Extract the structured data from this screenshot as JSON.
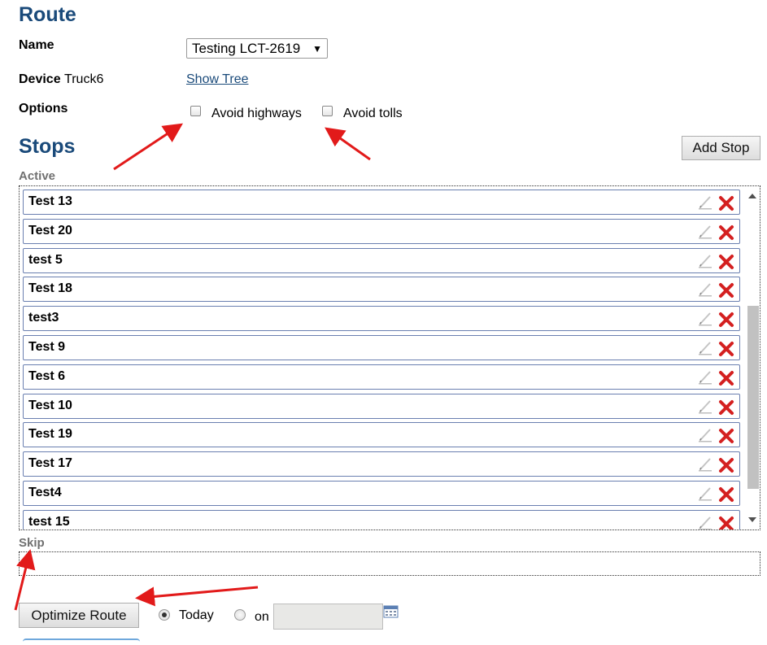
{
  "route": {
    "title": "Route",
    "name_label": "Name",
    "name_value": "Testing LCT-2619",
    "device_label": "Device",
    "device_value": "Truck6",
    "show_tree_label": "Show Tree",
    "options_label": "Options",
    "avoid_highways_label": "Avoid highways",
    "avoid_tolls_label": "Avoid tolls",
    "avoid_highways_checked": false,
    "avoid_tolls_checked": false
  },
  "stops": {
    "title": "Stops",
    "add_stop_label": "Add Stop",
    "active_label": "Active",
    "skip_label": "Skip",
    "active_items": [
      "Test 13",
      "Test 20",
      "test 5",
      "Test 18",
      "test3",
      "Test 9",
      "Test 6",
      "Test 10",
      "Test 19",
      "Test 17",
      "Test4",
      "test 15"
    ],
    "skip_items": []
  },
  "optimize": {
    "button_label": "Optimize Route",
    "today_label": "Today",
    "on_label": "on",
    "selected": "today",
    "date_value": ""
  },
  "colors": {
    "heading": "#1a4a7a",
    "stop_border": "#6a7fb0",
    "delete_red": "#d42020",
    "annotation_arrow": "#e21a1a"
  },
  "icons": {
    "edit": "edit-pencil-icon",
    "delete": "delete-x-icon",
    "calendar": "calendar-icon"
  }
}
